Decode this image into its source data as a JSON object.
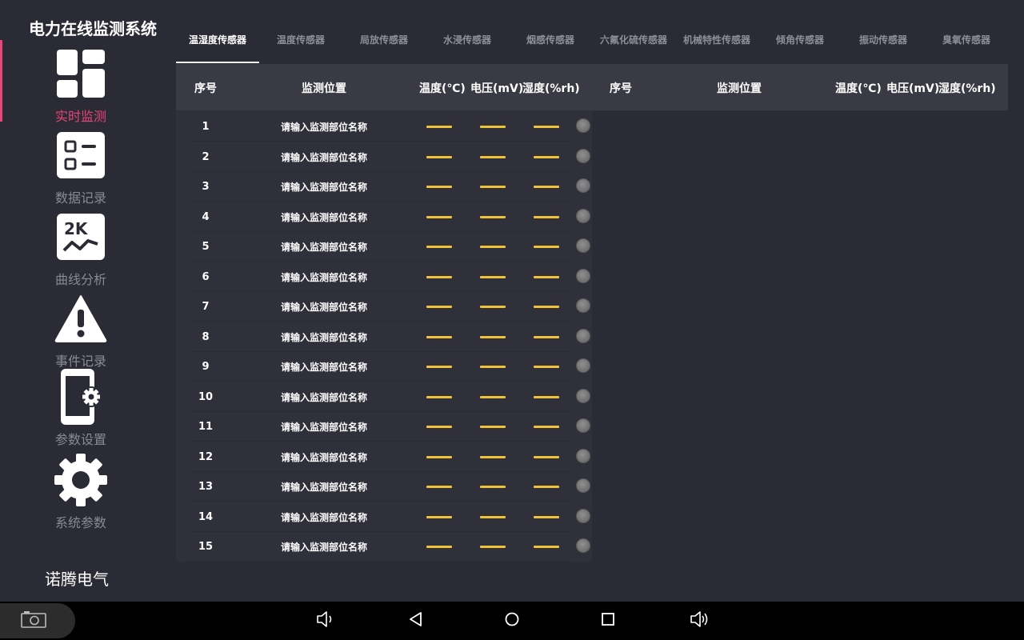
{
  "app": {
    "title": "电力在线监测系统",
    "brand": "诺腾电气"
  },
  "colors": {
    "accent": "#e8457a",
    "value_dash": "#f0c23a",
    "background": "#2b2b35"
  },
  "sidebar": {
    "items": [
      {
        "label": "实时监测",
        "icon": "grid-dashboard-icon",
        "active": true
      },
      {
        "label": "数据记录",
        "icon": "checklist-icon",
        "active": false
      },
      {
        "label": "曲线分析",
        "icon": "chart-line-icon",
        "active": false
      },
      {
        "label": "事件记录",
        "icon": "warning-icon",
        "active": false
      },
      {
        "label": "参数设置",
        "icon": "phone-settings-icon",
        "active": false
      },
      {
        "label": "系统参数",
        "icon": "gear-icon",
        "active": false
      }
    ]
  },
  "tabs": [
    {
      "label": "温湿度传感器",
      "active": true
    },
    {
      "label": "温度传感器",
      "active": false
    },
    {
      "label": "局放传感器",
      "active": false
    },
    {
      "label": "水浸传感器",
      "active": false
    },
    {
      "label": "烟感传感器",
      "active": false
    },
    {
      "label": "六氟化硫传感器",
      "active": false
    },
    {
      "label": "机械特性传感器",
      "active": false
    },
    {
      "label": "倾角传感器",
      "active": false
    },
    {
      "label": "振动传感器",
      "active": false
    },
    {
      "label": "臭氧传感器",
      "active": false
    }
  ],
  "table": {
    "headers": [
      "序号",
      "监测位置",
      "温度(℃)",
      "电压(mV)",
      "湿度(%rh)"
    ],
    "headers_right": [
      "序号",
      "监测位置",
      "温度(℃)",
      "电压(mV)",
      "湿度(%rh)"
    ],
    "rows": [
      {
        "num": "1",
        "location": "请输入监测部位名称"
      },
      {
        "num": "2",
        "location": "请输入监测部位名称"
      },
      {
        "num": "3",
        "location": "请输入监测部位名称"
      },
      {
        "num": "4",
        "location": "请输入监测部位名称"
      },
      {
        "num": "5",
        "location": "请输入监测部位名称"
      },
      {
        "num": "6",
        "location": "请输入监测部位名称"
      },
      {
        "num": "7",
        "location": "请输入监测部位名称"
      },
      {
        "num": "8",
        "location": "请输入监测部位名称"
      },
      {
        "num": "9",
        "location": "请输入监测部位名称"
      },
      {
        "num": "10",
        "location": "请输入监测部位名称"
      },
      {
        "num": "11",
        "location": "请输入监测部位名称"
      },
      {
        "num": "12",
        "location": "请输入监测部位名称"
      },
      {
        "num": "13",
        "location": "请输入监测部位名称"
      },
      {
        "num": "14",
        "location": "请输入监测部位名称"
      },
      {
        "num": "15",
        "location": "请输入监测部位名称"
      }
    ]
  },
  "system_bar": {
    "buttons": [
      "screenshot-icon",
      "volume-down-icon",
      "back-icon",
      "home-icon",
      "recents-icon",
      "volume-up-icon"
    ]
  }
}
